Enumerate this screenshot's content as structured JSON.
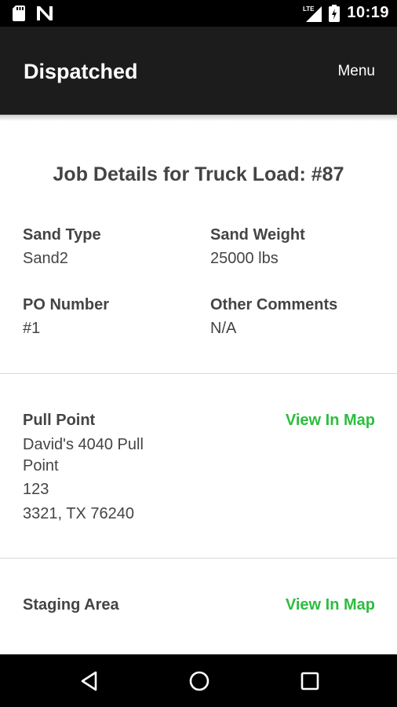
{
  "status_bar": {
    "time": "10:19",
    "network": "LTE",
    "icons": [
      "sd-card-icon",
      "n-notification-icon",
      "lte-signal-icon",
      "battery-charging-icon"
    ]
  },
  "app_bar": {
    "title": "Dispatched",
    "menu_label": "Menu"
  },
  "job": {
    "title": "Job Details for Truck Load: #87",
    "sand_type_label": "Sand Type",
    "sand_type_value": "Sand2",
    "sand_weight_label": "Sand Weight",
    "sand_weight_value": "25000 lbs",
    "po_label": "PO Number",
    "po_value": "#1",
    "comments_label": "Other Comments",
    "comments_value": "N/A"
  },
  "pull_point": {
    "label": "Pull Point",
    "map_link": "View In Map",
    "address_lines": [
      "David's 4040 Pull",
      "Point",
      "123",
      "3321, TX 76240"
    ]
  },
  "staging_area": {
    "label": "Staging Area",
    "map_link": "View In Map"
  },
  "nav_bar": {
    "buttons": [
      "back-icon",
      "home-icon",
      "recents-icon"
    ]
  },
  "colors": {
    "status_bar": "#000000",
    "app_bar": "#1c1c1c",
    "link_green": "#2ebd3e",
    "text": "#444444"
  }
}
